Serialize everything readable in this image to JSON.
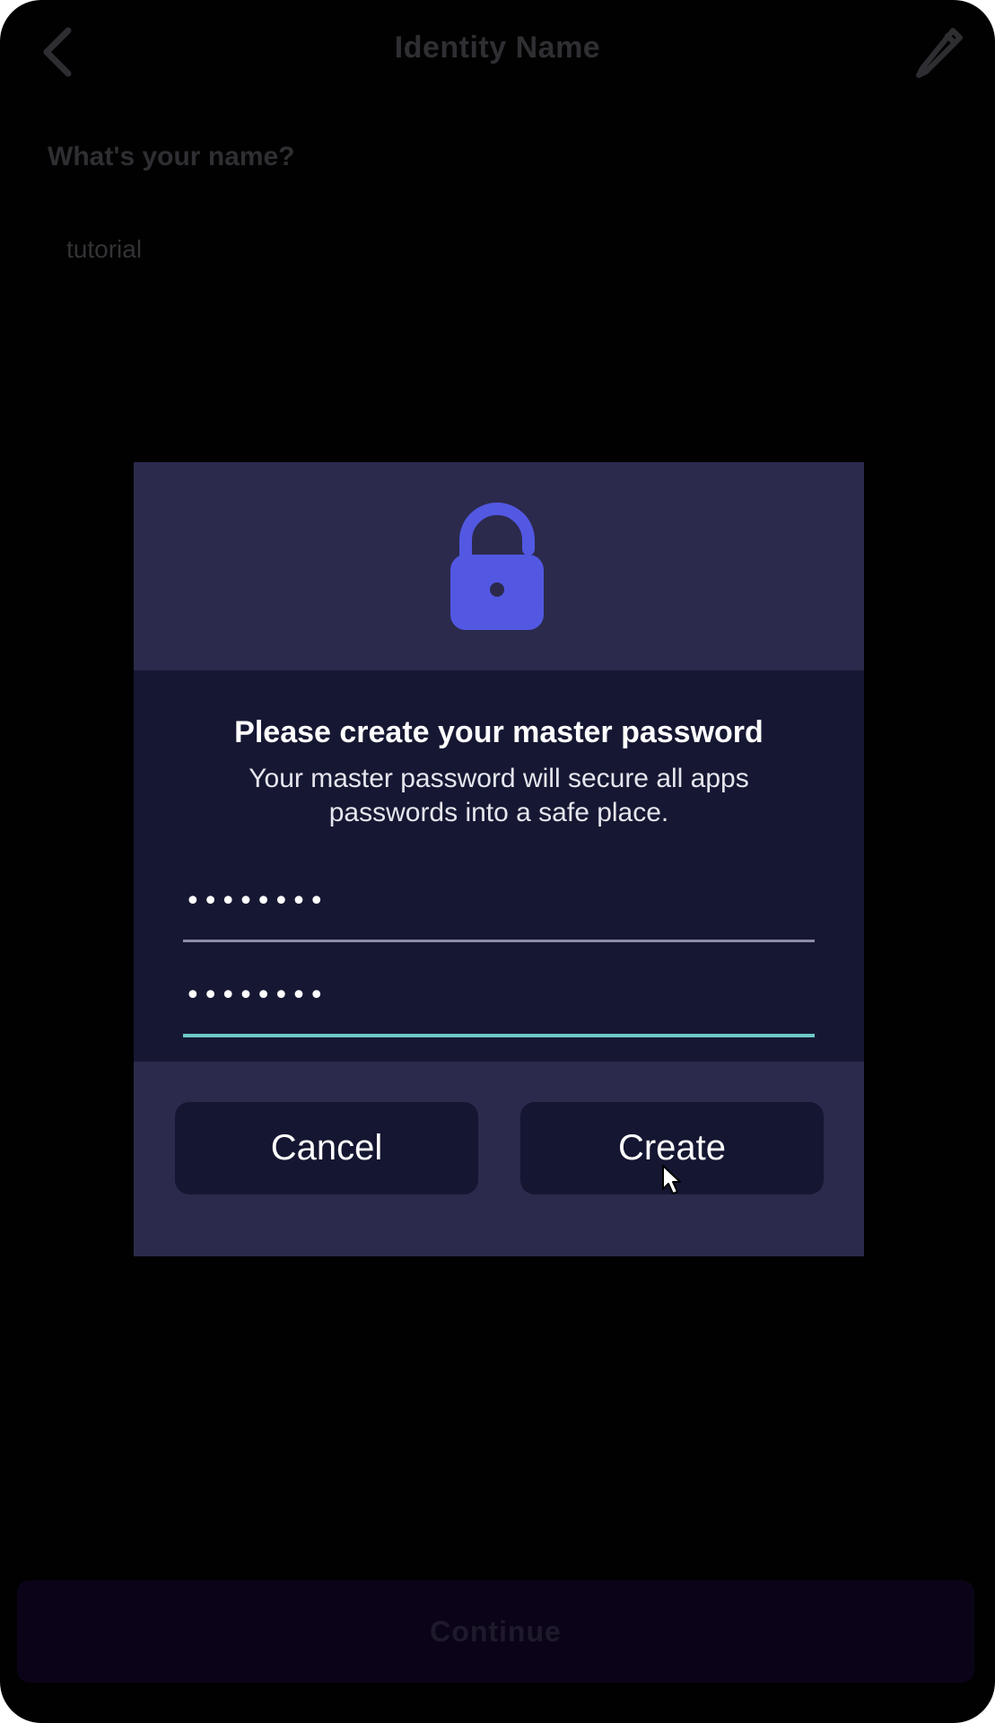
{
  "header": {
    "title": "Identity Name",
    "back_icon": "chevron-left-icon",
    "edit_icon": "pencil-icon"
  },
  "form": {
    "question": "What's your name?",
    "name_value": "tutorial"
  },
  "dialog": {
    "icon": "lock-open-icon",
    "title": "Please create your master password",
    "description": "Your master password will secure all apps passwords into a safe place.",
    "password_value": "12345678",
    "confirm_password_value": "12345678",
    "cancel_label": "Cancel",
    "create_label": "Create"
  },
  "footer": {
    "continue_label": "Continue"
  },
  "colors": {
    "background": "#010101",
    "dialog_header": "#2b2a4c",
    "dialog_body": "#161833",
    "button_bg": "#151631",
    "lock_accent": "#5258e2",
    "focus_underline": "#6ec9c4",
    "continue_bg": "#0b0419"
  }
}
